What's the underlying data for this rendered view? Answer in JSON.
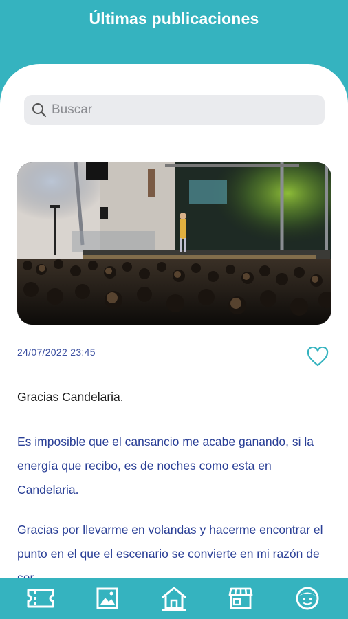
{
  "header": {
    "title": "Últimas publicaciones"
  },
  "search": {
    "placeholder": "Buscar"
  },
  "post": {
    "date": "24/07/2022 23:45",
    "liked": false,
    "title": "Gracias Candelaria.",
    "paragraphs": [
      "Es imposible que el cansancio me acabe ganando, si la energía que recibo, es de noches como esta en Candelaria.",
      "Gracias por llevarme en volandas y hacerme encontrar el punto en el que el escenario se convierte en mi razón de ser."
    ]
  },
  "bottom_nav": {
    "items": [
      {
        "icon": "ticket-icon"
      },
      {
        "icon": "image-icon"
      },
      {
        "icon": "home-icon",
        "active": true
      },
      {
        "icon": "store-icon"
      },
      {
        "icon": "profile-face-icon"
      }
    ]
  },
  "colors": {
    "primary": "#35b3bf",
    "body_text": "#2a3f96",
    "date_text": "#3b4fa0"
  }
}
